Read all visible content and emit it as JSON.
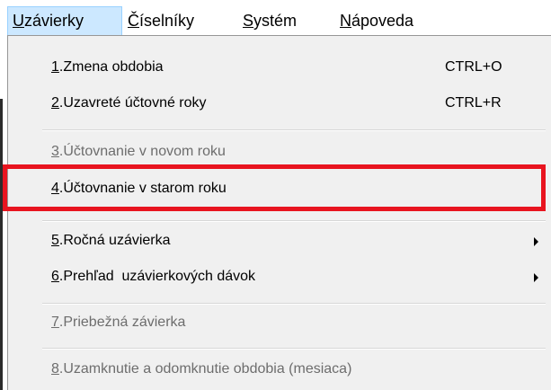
{
  "menubar": {
    "items": [
      {
        "label": "Uzávierky",
        "accelerator_index": 0,
        "active": true
      },
      {
        "label": "Číselníky",
        "accelerator_index": 0,
        "active": false
      },
      {
        "label": "Systém",
        "accelerator_index": 0,
        "active": false
      },
      {
        "label": "Nápoveda",
        "accelerator_index": 0,
        "active": false
      }
    ]
  },
  "dropdown": {
    "items": [
      {
        "number": "1",
        "text": ".Zmena obdobia",
        "shortcut": "CTRL+O",
        "enabled": true,
        "submenu": false
      },
      {
        "number": "2",
        "text": ".Uzavreté účtovné roky",
        "shortcut": "CTRL+R",
        "enabled": true,
        "submenu": false
      },
      {
        "number": "3",
        "text": ".Účtovnanie v novom roku",
        "shortcut": "",
        "enabled": false,
        "submenu": false
      },
      {
        "number": "4",
        "text": ".Účtovnanie v starom roku",
        "shortcut": "",
        "enabled": true,
        "submenu": false
      },
      {
        "number": "5",
        "text": ".Ročná uzávierka",
        "shortcut": "",
        "enabled": true,
        "submenu": true
      },
      {
        "number": "6",
        "text": ".Prehľad  uzávierkových dávok",
        "shortcut": "",
        "enabled": true,
        "submenu": true
      },
      {
        "number": "7",
        "text": ".Priebežná závierka",
        "shortcut": "",
        "enabled": false,
        "submenu": false
      },
      {
        "number": "8",
        "text": ".Uzamknutie a odomknutie obdobia (mesiaca)",
        "shortcut": "",
        "enabled": false,
        "submenu": false
      }
    ]
  },
  "colors": {
    "highlight_box": "#e8141f",
    "menubar_active_bg": "#cce8ff",
    "disabled_text": "#6d6d6d"
  }
}
